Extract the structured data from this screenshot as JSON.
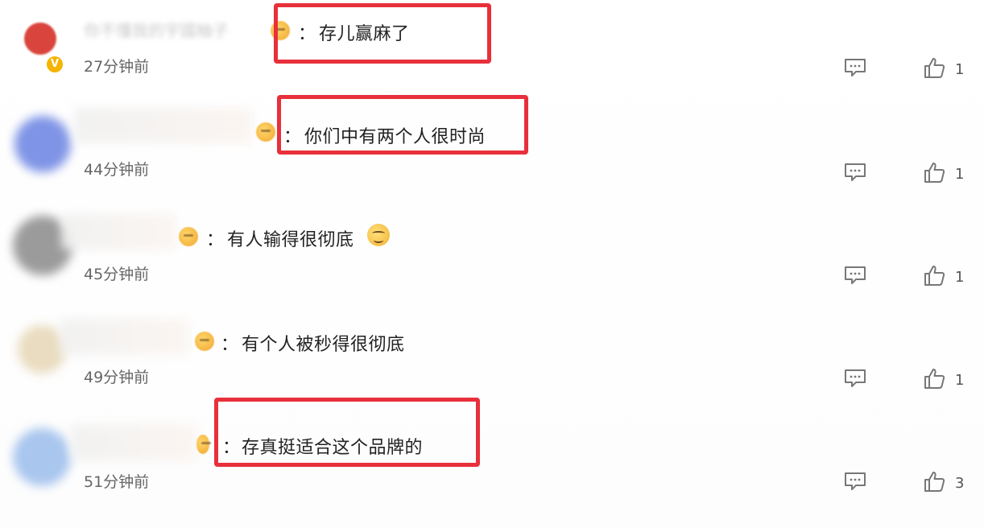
{
  "comments": [
    {
      "username": "你不懂我的宇國柚子",
      "text": "存儿赢麻了",
      "time": "27分钟前",
      "likes": "1",
      "avatar_color": "#d9453c",
      "verified_mark": "V",
      "highlighted": true
    },
    {
      "username": "",
      "text": "你们中有两个人很时尚",
      "time": "44分钟前",
      "likes": "1",
      "avatar_color": "#7f94e6",
      "highlighted": true
    },
    {
      "username": "",
      "text": "有人输得很彻底",
      "time": "45分钟前",
      "likes": "1",
      "avatar_color": "#9b9b9b",
      "highlighted": false
    },
    {
      "username": "",
      "text": "有个人被秒得很彻底",
      "time": "49分钟前",
      "likes": "1",
      "avatar_color": "#e9dcc0",
      "highlighted": false
    },
    {
      "username": "",
      "text": "存真挺适合这个品牌的",
      "time": "51分钟前",
      "likes": "3",
      "avatar_color": "#a9c6ee",
      "highlighted": true
    }
  ],
  "separator": "：",
  "icons": {
    "reply": "reply-icon",
    "like": "thumbs-up-icon",
    "emoji": "emoji-icon",
    "smirk": "smirk-emoji-icon"
  },
  "colors": {
    "highlight": "#e8303b",
    "text": "#222222",
    "time": "#666666"
  }
}
